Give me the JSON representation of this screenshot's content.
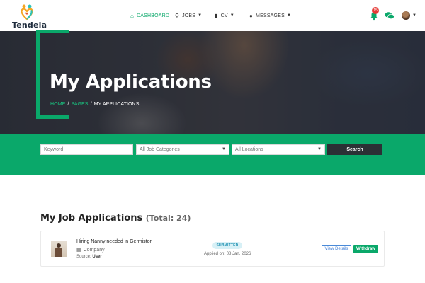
{
  "brand": {
    "name": "Tendela",
    "icon": "heart-people-logo"
  },
  "nav": {
    "items": [
      {
        "label": "DASHBOARD",
        "icon": "home-icon",
        "dropdown": false,
        "active": true
      },
      {
        "label": "JOBS",
        "icon": "search-icon",
        "dropdown": true
      },
      {
        "label": "CV",
        "icon": "document-icon",
        "dropdown": true
      },
      {
        "label": "MESSAGES",
        "icon": "chat-icon",
        "dropdown": true
      }
    ]
  },
  "header_icons": {
    "notifications": {
      "icon": "bell-icon",
      "count": "15"
    },
    "messages": {
      "icon": "chat-bubbles-icon"
    },
    "user": {
      "icon": "avatar"
    }
  },
  "hero": {
    "title": "My Applications",
    "breadcrumb": [
      "HOME",
      "PAGES",
      "MY APPLICATIONS"
    ]
  },
  "search": {
    "keyword_placeholder": "Keyword",
    "category_value": "All Job Categories",
    "location_value": "All Locations",
    "button_label": "Search"
  },
  "applications": {
    "heading": "My Job Applications",
    "total": "(Total: 24)",
    "items": [
      {
        "title": "Hiring Nanny needed in Germiston",
        "company": "Company",
        "source_label": "Source:",
        "source_value": "User",
        "status": "SUBMITTED",
        "applied": "Applied on: 08 Jan, 2026",
        "view_label": "View Details",
        "withdraw_label": "Withdraw"
      }
    ]
  },
  "colors": {
    "accent": "#0aa86a",
    "dark_button": "#2b3035",
    "badge": "#e53935"
  }
}
